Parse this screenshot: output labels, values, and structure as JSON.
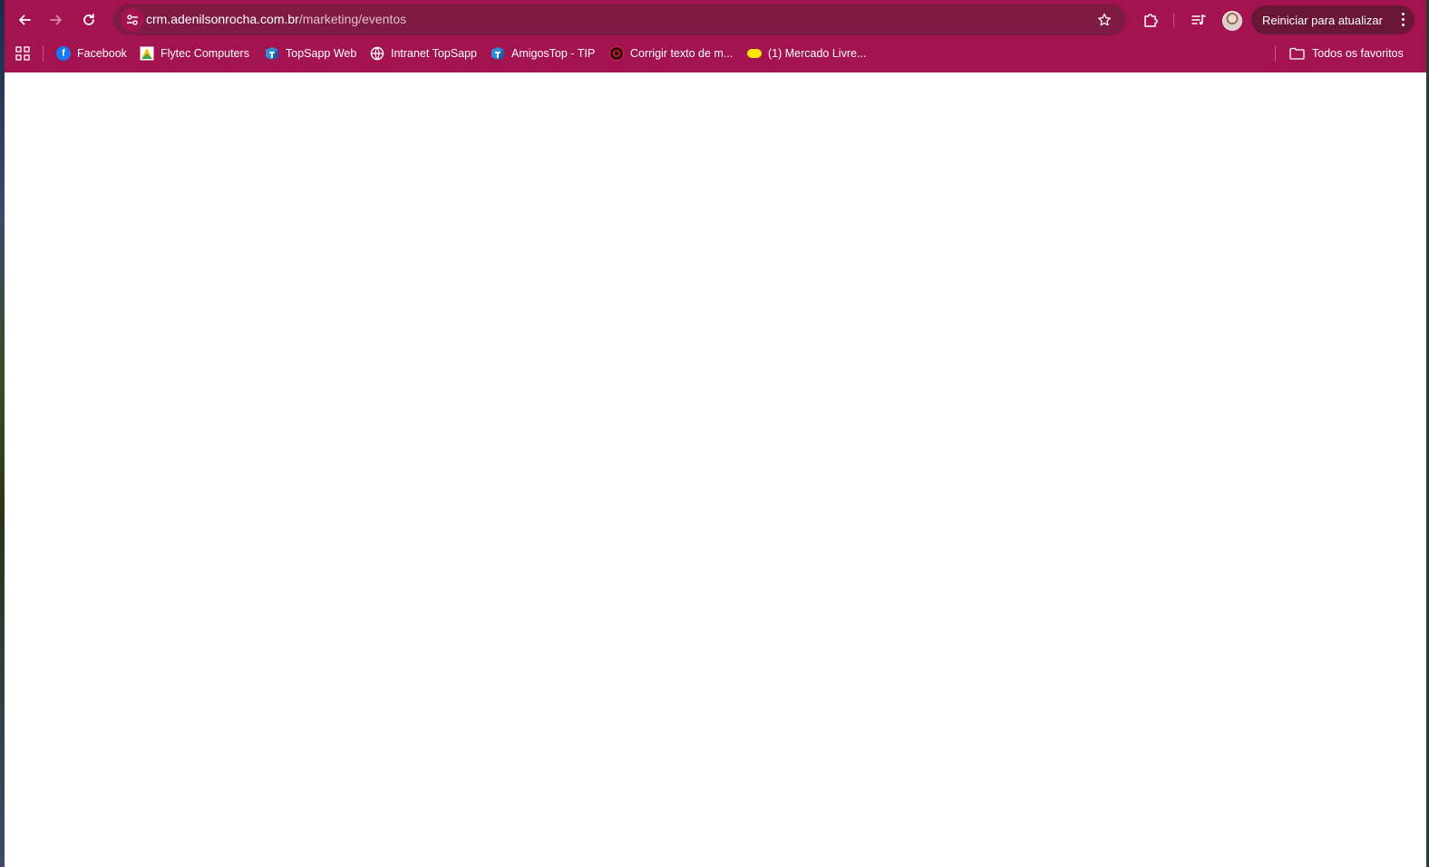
{
  "browser": {
    "url_domain": "crm.adenilsonrocha.com.br",
    "url_path": "/marketing/eventos",
    "restart_label": "Reiniciar para atualizar",
    "accent_color": "#a3134f",
    "icons": [
      "back-arrow-icon",
      "forward-arrow-icon",
      "reload-icon",
      "site-settings-icon",
      "star-icon",
      "extensions-icon",
      "media-controls-icon",
      "avatar",
      "kebab-menu-icon",
      "apps-grid-icon",
      "folder-icon"
    ]
  },
  "bookmarks": {
    "items": [
      {
        "label": "Facebook",
        "icon": "facebook-icon"
      },
      {
        "label": "Flytec Computers",
        "icon": "flytec-icon"
      },
      {
        "label": "TopSapp Web",
        "icon": "topsapp-icon"
      },
      {
        "label": "Intranet TopSapp",
        "icon": "globe-icon"
      },
      {
        "label": "AmigosTop - TIP",
        "icon": "topsapp-icon"
      },
      {
        "label": "Corrigir texto de m...",
        "icon": "red-circle-icon"
      },
      {
        "label": "(1) Mercado Livre...",
        "icon": "mercado-livre-icon"
      }
    ],
    "all_bookmarks_label": "Todos os favoritos"
  }
}
